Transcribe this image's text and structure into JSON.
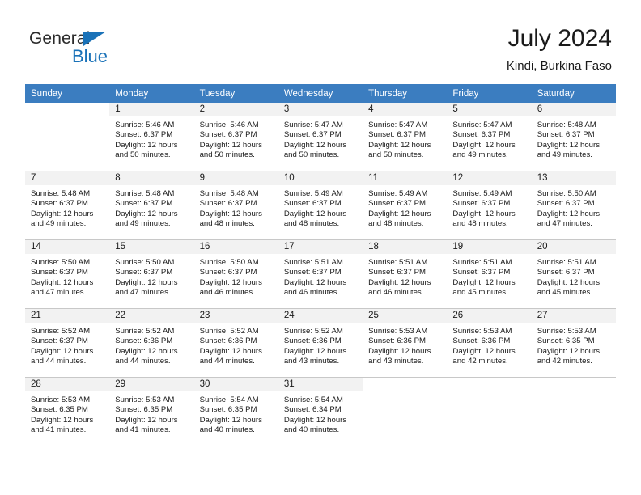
{
  "brand": {
    "name_part1": "General",
    "name_part2": "Blue",
    "flag_color": "#1a72b8"
  },
  "header": {
    "title": "July 2024",
    "subtitle": "Kindi, Burkina Faso",
    "header_bg_color": "#3b7dc0",
    "band_bg_color": "#f2f2f2"
  },
  "columns": [
    "Sunday",
    "Monday",
    "Tuesday",
    "Wednesday",
    "Thursday",
    "Friday",
    "Saturday"
  ],
  "weeks": [
    [
      {
        "day": "",
        "sunrise": "",
        "sunset": "",
        "daylight_line1": "",
        "daylight_line2": "",
        "blank": true
      },
      {
        "day": "1",
        "sunrise": "Sunrise: 5:46 AM",
        "sunset": "Sunset: 6:37 PM",
        "daylight_line1": "Daylight: 12 hours",
        "daylight_line2": "and 50 minutes."
      },
      {
        "day": "2",
        "sunrise": "Sunrise: 5:46 AM",
        "sunset": "Sunset: 6:37 PM",
        "daylight_line1": "Daylight: 12 hours",
        "daylight_line2": "and 50 minutes."
      },
      {
        "day": "3",
        "sunrise": "Sunrise: 5:47 AM",
        "sunset": "Sunset: 6:37 PM",
        "daylight_line1": "Daylight: 12 hours",
        "daylight_line2": "and 50 minutes."
      },
      {
        "day": "4",
        "sunrise": "Sunrise: 5:47 AM",
        "sunset": "Sunset: 6:37 PM",
        "daylight_line1": "Daylight: 12 hours",
        "daylight_line2": "and 50 minutes."
      },
      {
        "day": "5",
        "sunrise": "Sunrise: 5:47 AM",
        "sunset": "Sunset: 6:37 PM",
        "daylight_line1": "Daylight: 12 hours",
        "daylight_line2": "and 49 minutes."
      },
      {
        "day": "6",
        "sunrise": "Sunrise: 5:48 AM",
        "sunset": "Sunset: 6:37 PM",
        "daylight_line1": "Daylight: 12 hours",
        "daylight_line2": "and 49 minutes."
      }
    ],
    [
      {
        "day": "7",
        "sunrise": "Sunrise: 5:48 AM",
        "sunset": "Sunset: 6:37 PM",
        "daylight_line1": "Daylight: 12 hours",
        "daylight_line2": "and 49 minutes."
      },
      {
        "day": "8",
        "sunrise": "Sunrise: 5:48 AM",
        "sunset": "Sunset: 6:37 PM",
        "daylight_line1": "Daylight: 12 hours",
        "daylight_line2": "and 49 minutes."
      },
      {
        "day": "9",
        "sunrise": "Sunrise: 5:48 AM",
        "sunset": "Sunset: 6:37 PM",
        "daylight_line1": "Daylight: 12 hours",
        "daylight_line2": "and 48 minutes."
      },
      {
        "day": "10",
        "sunrise": "Sunrise: 5:49 AM",
        "sunset": "Sunset: 6:37 PM",
        "daylight_line1": "Daylight: 12 hours",
        "daylight_line2": "and 48 minutes."
      },
      {
        "day": "11",
        "sunrise": "Sunrise: 5:49 AM",
        "sunset": "Sunset: 6:37 PM",
        "daylight_line1": "Daylight: 12 hours",
        "daylight_line2": "and 48 minutes."
      },
      {
        "day": "12",
        "sunrise": "Sunrise: 5:49 AM",
        "sunset": "Sunset: 6:37 PM",
        "daylight_line1": "Daylight: 12 hours",
        "daylight_line2": "and 48 minutes."
      },
      {
        "day": "13",
        "sunrise": "Sunrise: 5:50 AM",
        "sunset": "Sunset: 6:37 PM",
        "daylight_line1": "Daylight: 12 hours",
        "daylight_line2": "and 47 minutes."
      }
    ],
    [
      {
        "day": "14",
        "sunrise": "Sunrise: 5:50 AM",
        "sunset": "Sunset: 6:37 PM",
        "daylight_line1": "Daylight: 12 hours",
        "daylight_line2": "and 47 minutes."
      },
      {
        "day": "15",
        "sunrise": "Sunrise: 5:50 AM",
        "sunset": "Sunset: 6:37 PM",
        "daylight_line1": "Daylight: 12 hours",
        "daylight_line2": "and 47 minutes."
      },
      {
        "day": "16",
        "sunrise": "Sunrise: 5:50 AM",
        "sunset": "Sunset: 6:37 PM",
        "daylight_line1": "Daylight: 12 hours",
        "daylight_line2": "and 46 minutes."
      },
      {
        "day": "17",
        "sunrise": "Sunrise: 5:51 AM",
        "sunset": "Sunset: 6:37 PM",
        "daylight_line1": "Daylight: 12 hours",
        "daylight_line2": "and 46 minutes."
      },
      {
        "day": "18",
        "sunrise": "Sunrise: 5:51 AM",
        "sunset": "Sunset: 6:37 PM",
        "daylight_line1": "Daylight: 12 hours",
        "daylight_line2": "and 46 minutes."
      },
      {
        "day": "19",
        "sunrise": "Sunrise: 5:51 AM",
        "sunset": "Sunset: 6:37 PM",
        "daylight_line1": "Daylight: 12 hours",
        "daylight_line2": "and 45 minutes."
      },
      {
        "day": "20",
        "sunrise": "Sunrise: 5:51 AM",
        "sunset": "Sunset: 6:37 PM",
        "daylight_line1": "Daylight: 12 hours",
        "daylight_line2": "and 45 minutes."
      }
    ],
    [
      {
        "day": "21",
        "sunrise": "Sunrise: 5:52 AM",
        "sunset": "Sunset: 6:37 PM",
        "daylight_line1": "Daylight: 12 hours",
        "daylight_line2": "and 44 minutes."
      },
      {
        "day": "22",
        "sunrise": "Sunrise: 5:52 AM",
        "sunset": "Sunset: 6:36 PM",
        "daylight_line1": "Daylight: 12 hours",
        "daylight_line2": "and 44 minutes."
      },
      {
        "day": "23",
        "sunrise": "Sunrise: 5:52 AM",
        "sunset": "Sunset: 6:36 PM",
        "daylight_line1": "Daylight: 12 hours",
        "daylight_line2": "and 44 minutes."
      },
      {
        "day": "24",
        "sunrise": "Sunrise: 5:52 AM",
        "sunset": "Sunset: 6:36 PM",
        "daylight_line1": "Daylight: 12 hours",
        "daylight_line2": "and 43 minutes."
      },
      {
        "day": "25",
        "sunrise": "Sunrise: 5:53 AM",
        "sunset": "Sunset: 6:36 PM",
        "daylight_line1": "Daylight: 12 hours",
        "daylight_line2": "and 43 minutes."
      },
      {
        "day": "26",
        "sunrise": "Sunrise: 5:53 AM",
        "sunset": "Sunset: 6:36 PM",
        "daylight_line1": "Daylight: 12 hours",
        "daylight_line2": "and 42 minutes."
      },
      {
        "day": "27",
        "sunrise": "Sunrise: 5:53 AM",
        "sunset": "Sunset: 6:35 PM",
        "daylight_line1": "Daylight: 12 hours",
        "daylight_line2": "and 42 minutes."
      }
    ],
    [
      {
        "day": "28",
        "sunrise": "Sunrise: 5:53 AM",
        "sunset": "Sunset: 6:35 PM",
        "daylight_line1": "Daylight: 12 hours",
        "daylight_line2": "and 41 minutes."
      },
      {
        "day": "29",
        "sunrise": "Sunrise: 5:53 AM",
        "sunset": "Sunset: 6:35 PM",
        "daylight_line1": "Daylight: 12 hours",
        "daylight_line2": "and 41 minutes."
      },
      {
        "day": "30",
        "sunrise": "Sunrise: 5:54 AM",
        "sunset": "Sunset: 6:35 PM",
        "daylight_line1": "Daylight: 12 hours",
        "daylight_line2": "and 40 minutes."
      },
      {
        "day": "31",
        "sunrise": "Sunrise: 5:54 AM",
        "sunset": "Sunset: 6:34 PM",
        "daylight_line1": "Daylight: 12 hours",
        "daylight_line2": "and 40 minutes."
      },
      {
        "day": "",
        "sunrise": "",
        "sunset": "",
        "daylight_line1": "",
        "daylight_line2": "",
        "blank": true
      },
      {
        "day": "",
        "sunrise": "",
        "sunset": "",
        "daylight_line1": "",
        "daylight_line2": "",
        "blank": true
      },
      {
        "day": "",
        "sunrise": "",
        "sunset": "",
        "daylight_line1": "",
        "daylight_line2": "",
        "blank": true
      }
    ]
  ]
}
